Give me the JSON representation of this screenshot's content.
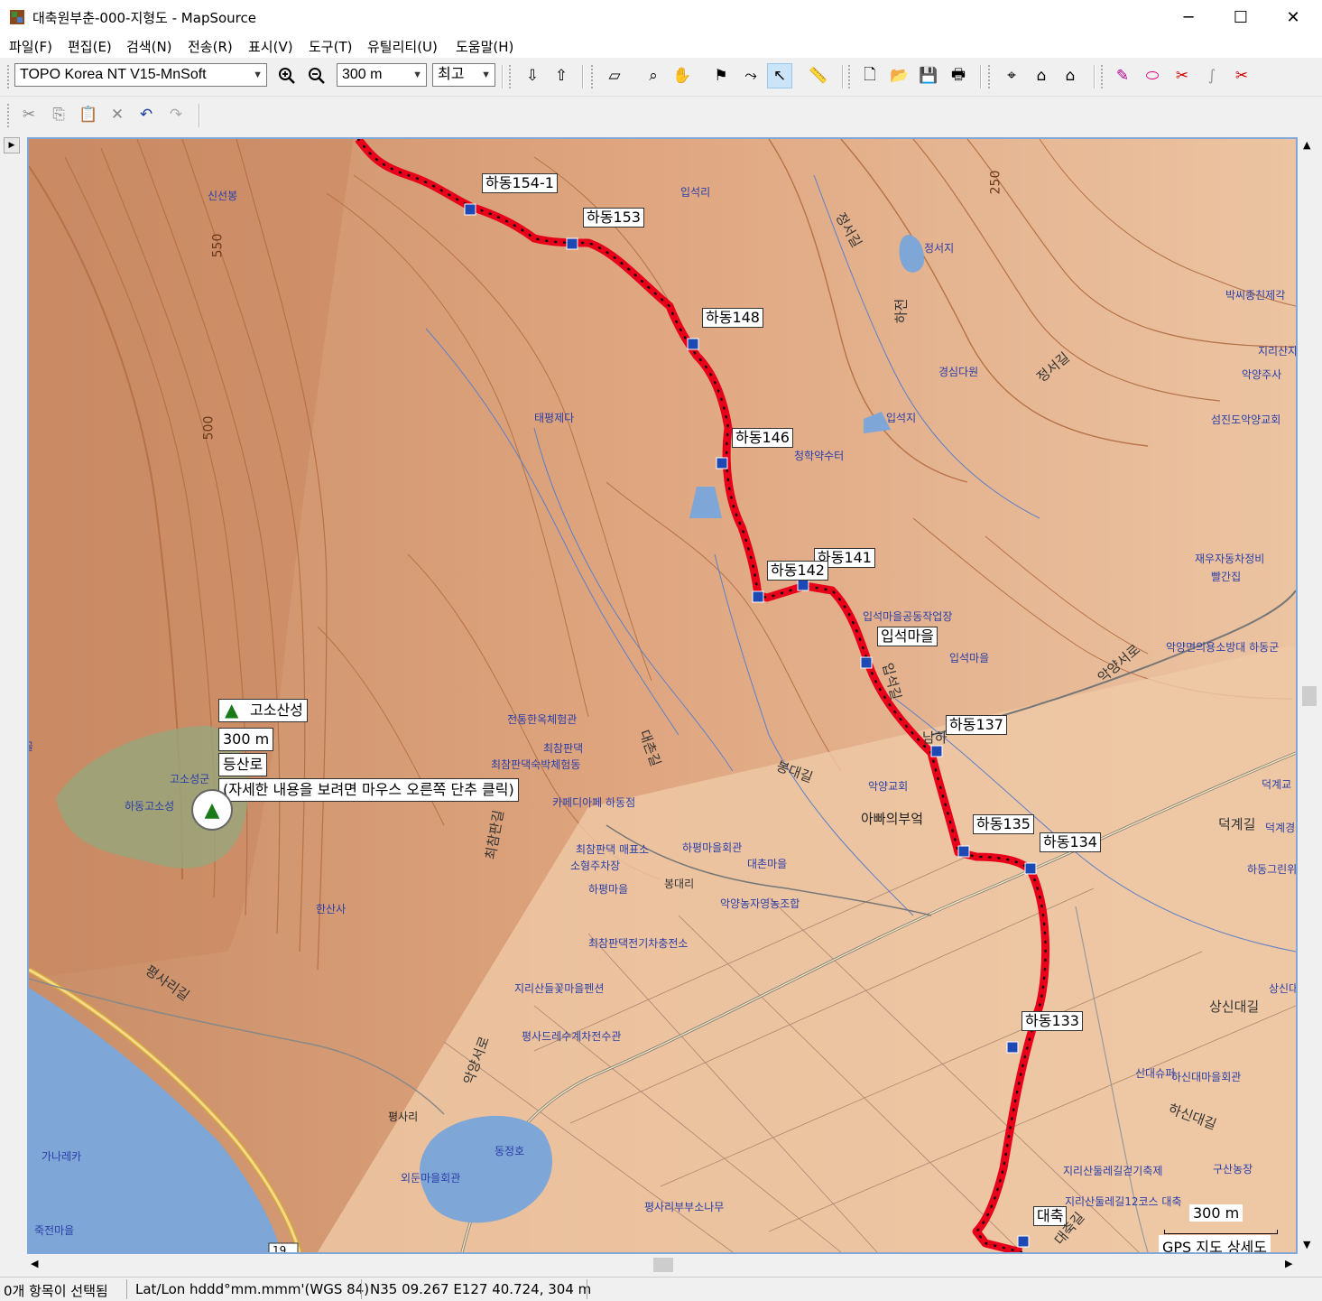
{
  "window": {
    "title": "대축원부춘-000-지형도 - MapSource",
    "min_label": "─",
    "max_label": "☐",
    "close_label": "✕"
  },
  "menu": [
    "파일(F)",
    "편집(E)",
    "검색(N)",
    "전송(R)",
    "표시(V)",
    "도구(T)",
    "유틸리티(U)",
    "도움말(H)"
  ],
  "toolbar": {
    "map_product": "TOPO Korea NT V15-MnSoft",
    "zoom_scale": "300 m",
    "detail_level": "최고"
  },
  "map": {
    "waypoints": [
      {
        "label": "하동154-1"
      },
      {
        "label": "하동153"
      },
      {
        "label": "하동148"
      },
      {
        "label": "하동146"
      },
      {
        "label": "하동141"
      },
      {
        "label": "하동142"
      },
      {
        "label": "입석마을"
      },
      {
        "label": "하동137"
      },
      {
        "label": "하동135"
      },
      {
        "label": "하동134"
      },
      {
        "label": "하동133"
      },
      {
        "label": "대축"
      }
    ],
    "tooltip": {
      "name": "고소산성",
      "distance": "300 m",
      "type": "등산로",
      "hint": "(자세한 내용을 보려면 마우스 오른쪽 단추 클릭)"
    },
    "places": [
      "신선봉",
      "입석리",
      "정서지",
      "박씨종친제각",
      "지리산자",
      "악양주사",
      "경심다원",
      "입석지",
      "섬진도악양교회",
      "태평제다",
      "청학약수터",
      "재우자동차정비",
      "빨간집",
      "입석마을공동작업장",
      "입석마을",
      "악양면의용소방대 하동군",
      "전통한옥체험관",
      "최참판댁",
      "최참판댁숙박체험동",
      "고소성군",
      "하동고소성",
      "카페디아페 하동점",
      "악양교회",
      "아빠의부엌",
      "덕계교",
      "하동그린위",
      "최참판댁 매표소",
      "하평마을회관",
      "소형주차장",
      "대촌마을",
      "하평마을",
      "봉대리",
      "악양농자영농조합",
      "한산사",
      "최참판댁전기차충전소",
      "지리산들꽃마을펜션",
      "상신대마을",
      "평사드레수계차전수관",
      "신대슈퍼",
      "하신대마을회관",
      "평사리",
      "동정호",
      "가나레카",
      "외둔마을회관",
      "지리산둘레길걷기축제",
      "구산농장",
      "평사리부부소나무",
      "지리산둘레길12코스 대축",
      "죽전마을",
      "덕계경"
    ],
    "roads": [
      "정서길",
      "하전",
      "정서길",
      "입석길",
      "대촌길",
      "봉대길",
      "최참판길",
      "악양서로",
      "평사리길",
      "덕계길",
      "상신대길",
      "하신대길",
      "대축길",
      "악양서로",
      "남하"
    ],
    "contours": [
      "550",
      "500",
      "250"
    ],
    "highway": "19",
    "scale_bar": "300 m",
    "copyright": "GPS 지도 상세도",
    "edge_label": "골"
  },
  "status": {
    "selection": "0개 항목이 선택됨",
    "format": "Lat/Lon hddd°mm.mmm'(WGS 84)",
    "position": "N35 09.267 E127 40.724, 304 m"
  },
  "colors": {
    "terrain": "#e7b590",
    "track": "#e8001a",
    "water": "#7ea6d6",
    "forest": "#9aa57a",
    "label_text": "#2a3ea8"
  }
}
